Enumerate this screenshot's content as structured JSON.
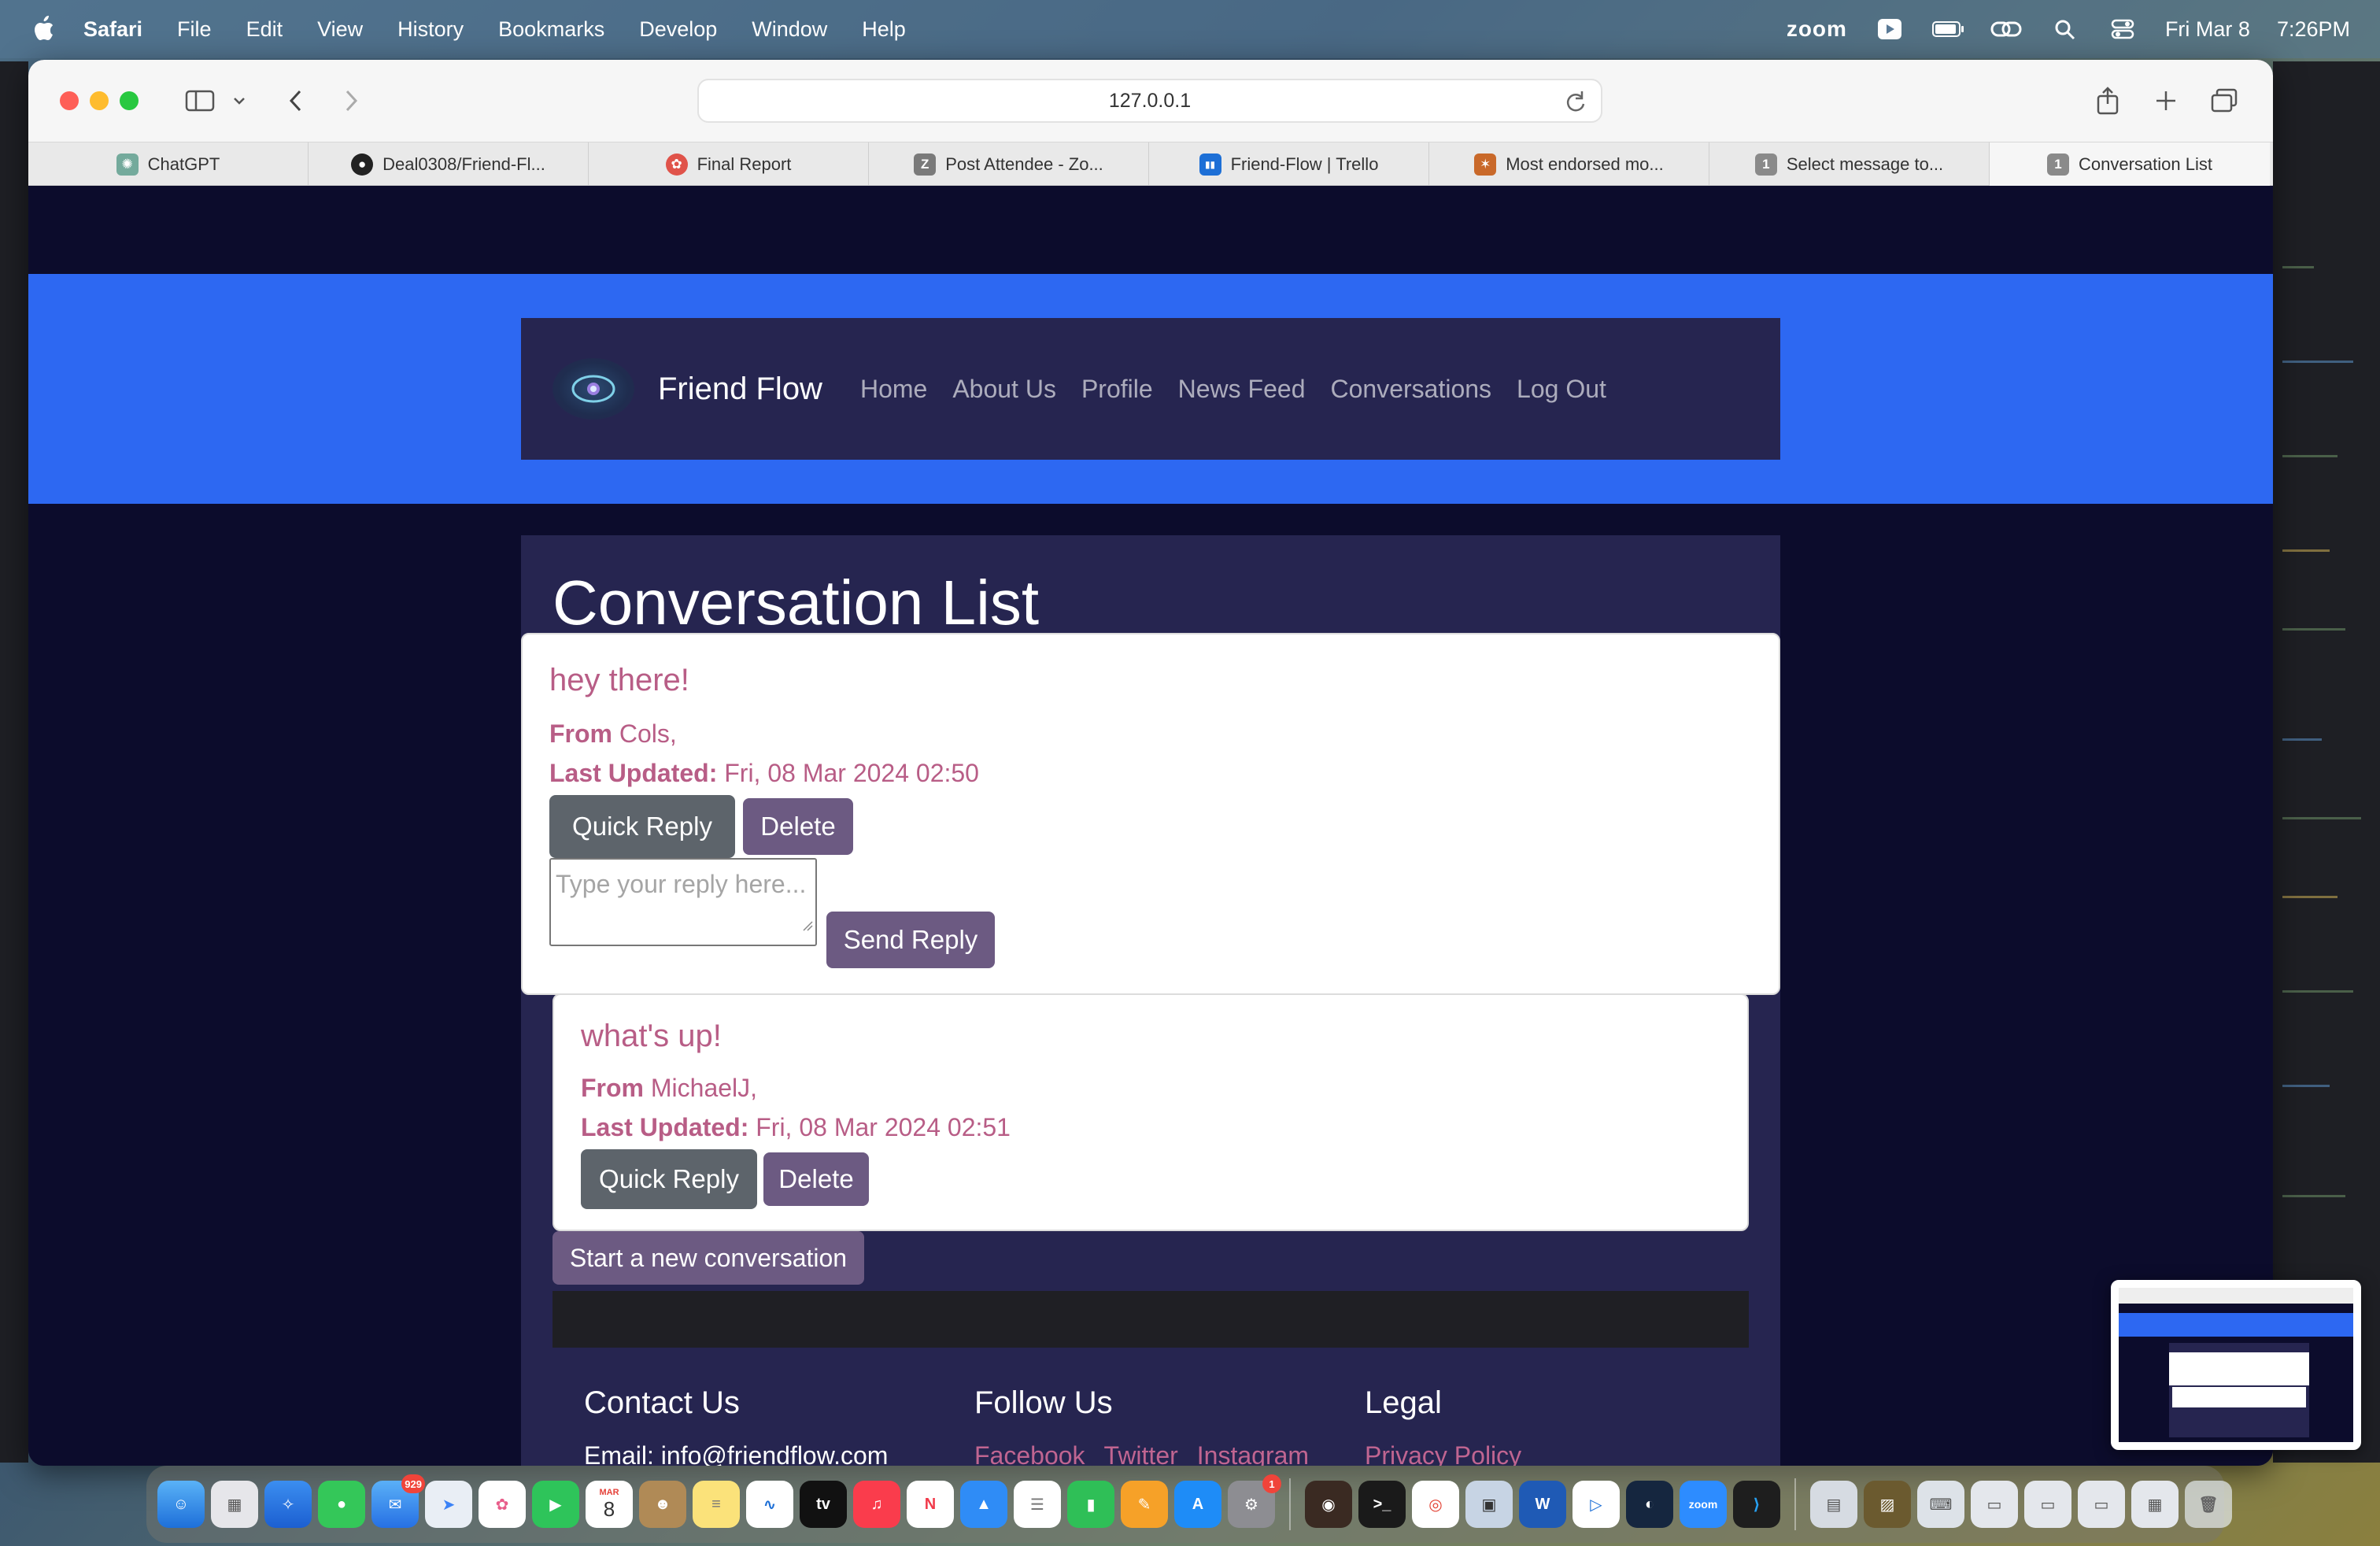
{
  "menubar": {
    "app_name": "Safari",
    "items": [
      "File",
      "Edit",
      "View",
      "History",
      "Bookmarks",
      "Develop",
      "Window",
      "Help"
    ],
    "zoom_label": "zoom",
    "date": "Fri Mar 8",
    "time": "7:26PM"
  },
  "browser": {
    "url": "127.0.0.1",
    "tabs": [
      {
        "title": "ChatGPT",
        "icon": "chatgpt-icon",
        "color": "#74aa9c",
        "glyph": "✺"
      },
      {
        "title": "Deal0308/Friend-Fl...",
        "icon": "github-icon",
        "color": "#222222",
        "glyph": "●"
      },
      {
        "title": "Final Report",
        "icon": "report-icon",
        "color": "#e0534a",
        "glyph": "✿"
      },
      {
        "title": "Post Attendee - Zo...",
        "icon": "zoom-icon",
        "color": "#7a7a7a",
        "glyph": "Z"
      },
      {
        "title": "Friend-Flow | Trello",
        "icon": "trello-icon",
        "color": "#1d6fd6",
        "glyph": "▮▮"
      },
      {
        "title": "Most endorsed mo...",
        "icon": "site-icon",
        "color": "#c9692a",
        "glyph": "✶"
      },
      {
        "title": "Select message to...",
        "icon": "number-one-icon",
        "color": "#8a8a8a",
        "glyph": "1"
      },
      {
        "title": "Conversation List",
        "icon": "number-one-icon",
        "color": "#8a8a8a",
        "glyph": "1"
      }
    ]
  },
  "site": {
    "brand": "Friend Flow",
    "nav": [
      "Home",
      "About Us",
      "Profile",
      "News Feed",
      "Conversations",
      "Log Out"
    ],
    "page_title": "Conversation List",
    "conversations": [
      {
        "title": "hey there!",
        "from_label": "From",
        "from_value": "Cols,",
        "updated_label": "Last Updated:",
        "updated_value": "Fri, 08 Mar 2024 02:50",
        "quick_reply": "Quick Reply",
        "delete": "Delete",
        "reply_placeholder": "Type your reply here...",
        "send_reply": "Send Reply"
      },
      {
        "title": "what's up!",
        "from_label": "From",
        "from_value": "MichaelJ,",
        "updated_label": "Last Updated:",
        "updated_value": "Fri, 08 Mar 2024 02:51",
        "quick_reply": "Quick Reply",
        "delete": "Delete"
      }
    ],
    "new_conversation": "Start a new conversation",
    "footer": {
      "contact_title": "Contact Us",
      "contact_email": "Email: info@friendflow.com",
      "follow_title": "Follow Us",
      "follow_links": [
        "Facebook",
        "Twitter",
        "Instagram"
      ],
      "legal_title": "Legal",
      "legal_links": [
        "Privacy Policy"
      ]
    }
  },
  "dock": {
    "mail_badge": "929",
    "calendar_month": "MAR",
    "calendar_day": "8",
    "settings_badge": "1"
  },
  "colors": {
    "page_bg": "#0c0c2c",
    "band_blue": "#2d68f2",
    "panel": "#262550",
    "accent_pink": "#b85d86",
    "button_gray": "#5d646b",
    "button_purple": "#6c5a82"
  }
}
